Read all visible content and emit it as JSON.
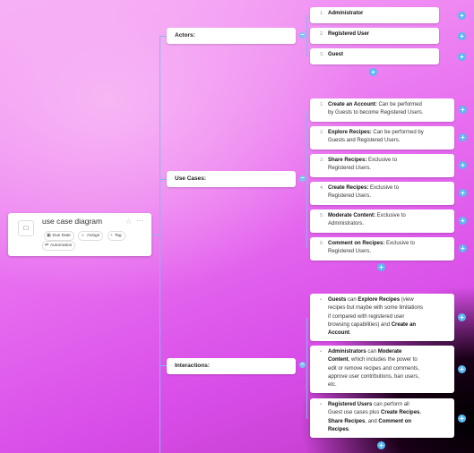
{
  "root": {
    "title": "use case diagram",
    "chips": [
      "Due Date",
      "Assign",
      "Tag",
      "Automation"
    ]
  },
  "actors": {
    "label": "Actors:",
    "items": [
      {
        "num": "1.",
        "text": "Administrator"
      },
      {
        "num": "2.",
        "text": "Registered User"
      },
      {
        "num": "3.",
        "text": "Guest"
      }
    ]
  },
  "use_cases": {
    "label": "Use Cases:",
    "items": [
      {
        "num": "1.",
        "bold": "Create an Account:",
        "line1": " Can be performed",
        "line2": "by Guests to become Registered Users."
      },
      {
        "num": "2.",
        "bold": "Explore Recipes:",
        "line1": " Can be performed by",
        "line2": "Guests and Registered Users."
      },
      {
        "num": "3.",
        "bold": "Share Recipes:",
        "line1": " Exclusive to",
        "line2": "Registered Users."
      },
      {
        "num": "4.",
        "bold": "Create Recipes:",
        "line1": " Exclusive to",
        "line2": "Registered Users."
      },
      {
        "num": "5.",
        "bold": "Moderate Content:",
        "line1": " Exclusive to",
        "line2": "Administrators."
      },
      {
        "num": "6.",
        "bold": "Comment on Recipes:",
        "line1": " Exclusive to",
        "line2": "Registered Users."
      }
    ]
  },
  "interactions": {
    "label": "Interactions:",
    "items": [
      {
        "b1": "Guests",
        "t1": " can ",
        "b2": "Explore Recipes",
        "t2": " (view",
        "l2": "recipes but maybe with some limitations",
        "l3": "if compared with registered user",
        "l4": "browsing capabilities) and ",
        "b3": "Create an",
        "b4": "Account",
        "t4": "."
      },
      {
        "b1": "Administrators",
        "t1": " can ",
        "b2": "Moderate",
        "b3": "Content",
        "t3": ", which includes the power to",
        "l3": "edit or remove recipes and comments,",
        "l4": "approve user contributions, ban users,",
        "l5": "etc."
      },
      {
        "b1": "Registered Users",
        "t1": " can perform all",
        "l2": "Guest use cases plus ",
        "b2": "Create Recipes",
        "t2": ",",
        "b3": "Share Recipes",
        "t3": ", and ",
        "b4": "Comment on",
        "b5": "Recipes",
        "t5": "."
      }
    ]
  },
  "icons": {
    "collapse": "minus-icon",
    "add": "plus-icon",
    "bullet": "bullet-icon"
  }
}
